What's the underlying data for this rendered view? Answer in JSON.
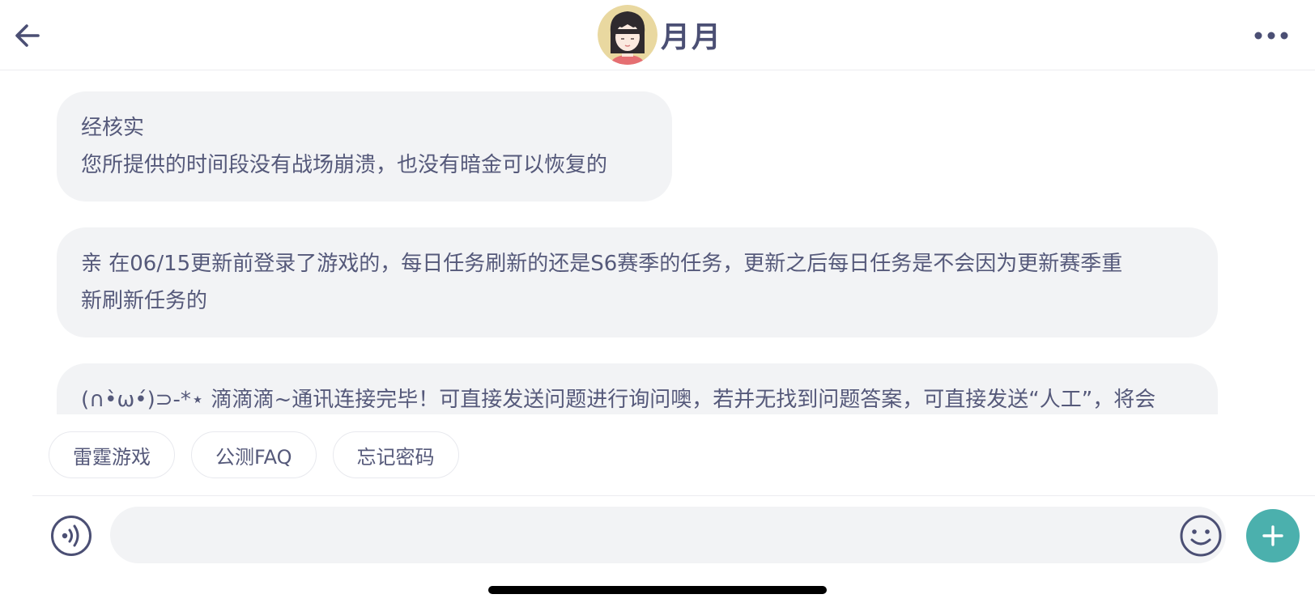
{
  "header": {
    "back_icon": "arrow-left-icon",
    "title": "月月",
    "avatar_icon": "girl-avatar-icon",
    "more_icon": "more-dots-icon"
  },
  "messages": [
    {
      "lines": [
        "经核实",
        "您所提供的时间段没有战场崩溃，也没有暗金可以恢复的"
      ]
    },
    {
      "lines": [
        "亲 在06/15更新前登录了游戏的，每日任务刷新的还是S6赛季的任务，更新之后每日任务是不会因为更新赛季重",
        "新刷新任务的"
      ]
    },
    {
      "lines": [
        "(∩•̀ω•́)⊃-*⋆ 滴滴滴~通讯连接完毕！可直接发送问题进行询问噢，若并无找到问题答案，可直接发送“人工”，将会"
      ]
    }
  ],
  "quick_replies": [
    "雷霆游戏",
    "公测FAQ",
    "忘记密码"
  ],
  "input_bar": {
    "voice_icon": "voice-icon",
    "input_value": "",
    "emoji_icon": "smiley-icon",
    "plus_icon": "plus-icon"
  },
  "colors": {
    "accent": "#4bb0ad",
    "bubble_bg": "#f2f3f5",
    "text": "#55597a",
    "title": "#4b4f74"
  }
}
